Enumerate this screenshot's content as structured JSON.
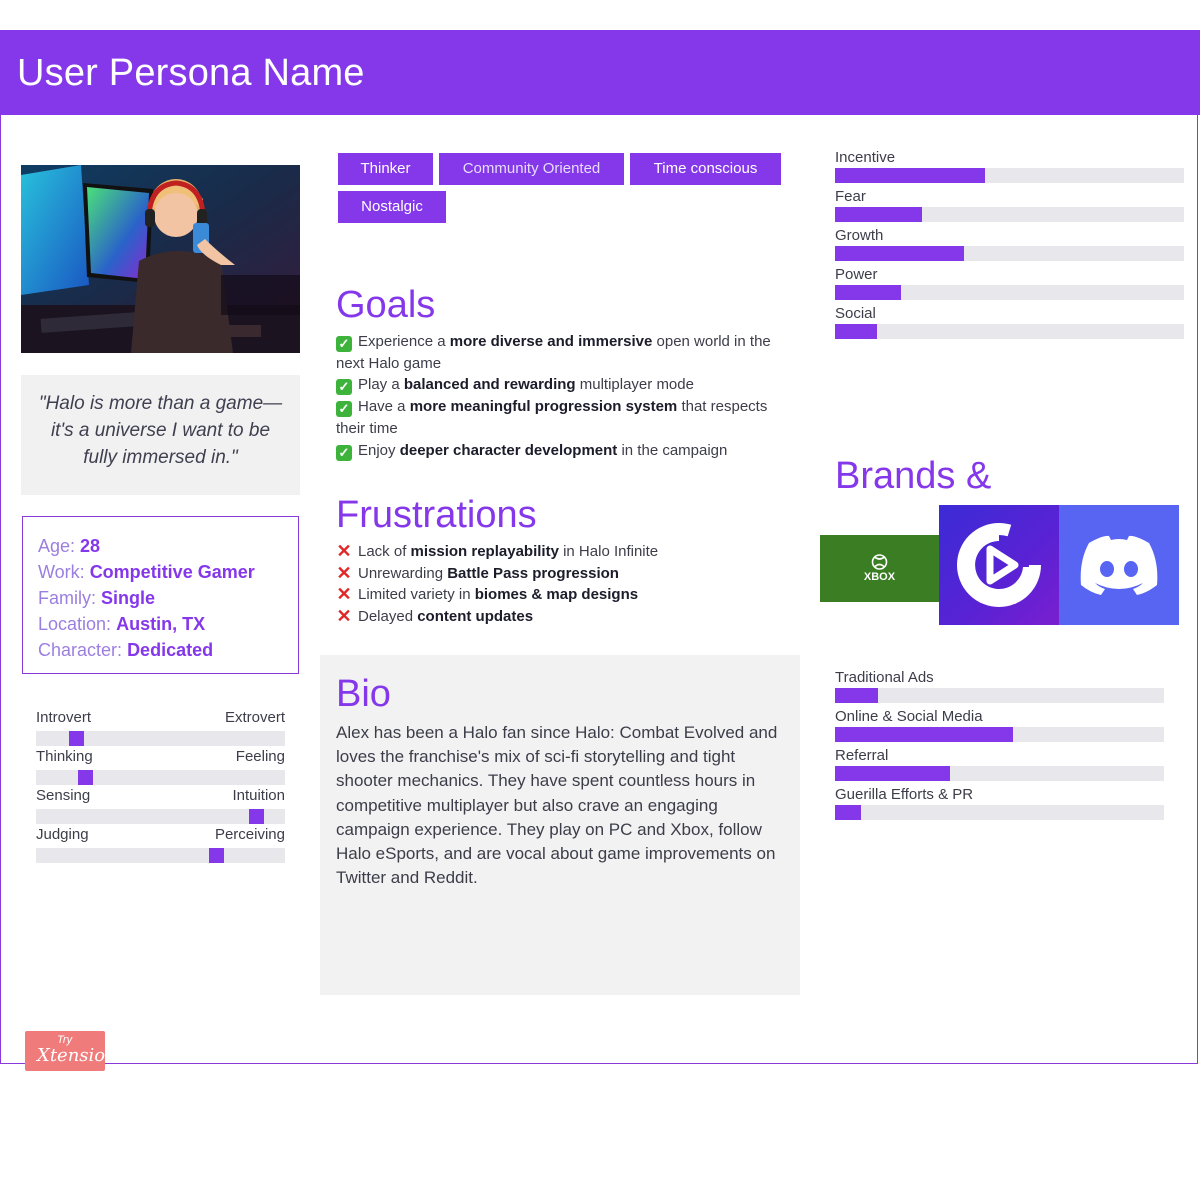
{
  "header": {
    "title": "User Persona Name"
  },
  "quote": "\"Halo is more than a game—it's a universe I want to be fully immersed in.\"",
  "info": [
    {
      "label": "Age:",
      "value": "28"
    },
    {
      "label": "Work:",
      "value": "Competitive Gamer"
    },
    {
      "label": "Family:",
      "value": "Single"
    },
    {
      "label": "Location:",
      "value": "Austin, TX"
    },
    {
      "label": "Character:",
      "value": "Dedicated"
    }
  ],
  "personality": [
    {
      "left": "Introvert",
      "right": "Extrovert",
      "value": 0.14
    },
    {
      "left": "Thinking",
      "right": "Feeling",
      "value": 0.18
    },
    {
      "left": "Sensing",
      "right": "Intuition",
      "value": 0.91
    },
    {
      "left": "Judging",
      "right": "Perceiving",
      "value": 0.74
    }
  ],
  "tags": [
    "Thinker",
    "Community Oriented",
    "Time conscious",
    "Nostalgic"
  ],
  "goals": {
    "title": "Goals",
    "items": [
      {
        "pre": "Experience a ",
        "bold": "more diverse and immersive",
        "post": " open world in the next Halo game"
      },
      {
        "pre": "Play a ",
        "bold": "balanced and rewarding",
        "post": " multiplayer mode"
      },
      {
        "pre": "Have a ",
        "bold": "more meaningful progression system",
        "post": " that respects their time"
      },
      {
        "pre": "Enjoy ",
        "bold": "deeper character development",
        "post": " in the campaign"
      }
    ]
  },
  "frustrations": {
    "title": "Frustrations",
    "items": [
      {
        "pre": "Lack of ",
        "bold": "mission replayability",
        "post": " in Halo Infinite"
      },
      {
        "pre": "Unrewarding ",
        "bold": "Battle Pass progression",
        "post": ""
      },
      {
        "pre": "Limited variety in ",
        "bold": "biomes & map designs",
        "post": ""
      },
      {
        "pre": "Delayed ",
        "bold": "content updates",
        "post": ""
      }
    ]
  },
  "bio": {
    "title": "Bio",
    "text": "Alex has been a Halo fan since Halo: Combat Evolved and loves the franchise's mix of sci-fi storytelling and tight shooter mechanics. They have spent countless hours in competitive multiplayer but also crave an engaging campaign experience. They play on PC and Xbox, follow Halo eSports, and are vocal about game improvements on Twitter and Reddit."
  },
  "motivations": [
    {
      "label": "Incentive",
      "value": 0.43
    },
    {
      "label": "Fear",
      "value": 0.25
    },
    {
      "label": "Growth",
      "value": 0.37
    },
    {
      "label": "Power",
      "value": 0.19
    },
    {
      "label": "Social",
      "value": 0.12
    }
  ],
  "brands": {
    "title": "Brands &",
    "items": [
      {
        "name": "XBOX",
        "icon": "xbox-logo"
      },
      {
        "name": "",
        "icon": "elgato-logo"
      },
      {
        "name": "",
        "icon": "discord-logo"
      }
    ]
  },
  "channels": [
    {
      "label": "Traditional Ads",
      "value": 0.13
    },
    {
      "label": "Online & Social Media",
      "value": 0.54
    },
    {
      "label": "Referral",
      "value": 0.35
    },
    {
      "label": "Guerilla Efforts & PR",
      "value": 0.08
    }
  ],
  "footer_badge": {
    "try": "Try",
    "brand": "Xtensio"
  },
  "colors": {
    "accent": "#8537ea",
    "panel": "#f2f2f2",
    "track": "#e8e8ec"
  }
}
